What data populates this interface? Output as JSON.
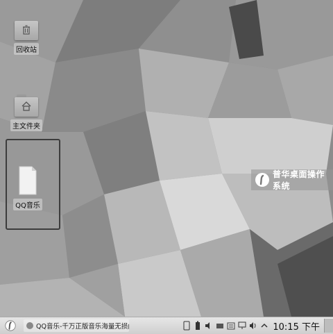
{
  "desktop": {
    "icons": [
      {
        "label": "回收站",
        "kind": "trash"
      },
      {
        "label": "主文件夹",
        "kind": "home"
      },
      {
        "label": "QQ音乐",
        "kind": "file",
        "selected": true
      }
    ]
  },
  "brand": {
    "text": "普华桌面操作系统"
  },
  "taskbar": {
    "task_label": "QQ音乐-千万正版音乐海量无损曲库新",
    "tray_icons": [
      "phone-icon",
      "battery-icon",
      "volume-icon",
      "drive-icon",
      "folder-icon",
      "display-icon",
      "speaker-icon",
      "chevron-up-icon"
    ],
    "time": "10:15",
    "ampm": "下午"
  }
}
